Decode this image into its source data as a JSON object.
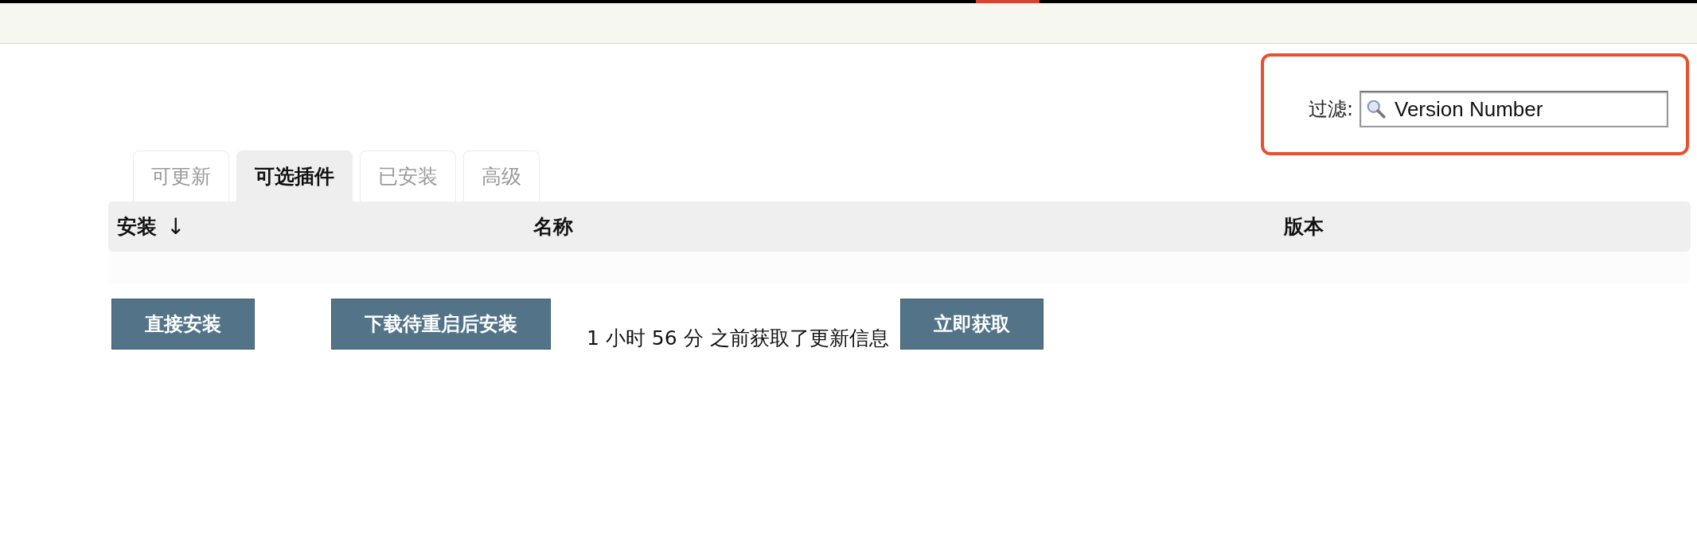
{
  "filter": {
    "label": "过滤:",
    "value": "Version Number"
  },
  "tabs": [
    {
      "label": "可更新",
      "selected": false
    },
    {
      "label": "可选插件",
      "selected": true
    },
    {
      "label": "已安装",
      "selected": false
    },
    {
      "label": "高级",
      "selected": false
    }
  ],
  "table": {
    "columns": [
      {
        "label": "安装",
        "sort": "↓"
      },
      {
        "label": "名称"
      },
      {
        "label": "版本"
      }
    ]
  },
  "actions": {
    "install_now": "直接安装",
    "install_after_restart": "下载待重启后安装",
    "status": "1 小时 56 分 之前获取了更新信息",
    "fetch_now": "立即获取"
  }
}
